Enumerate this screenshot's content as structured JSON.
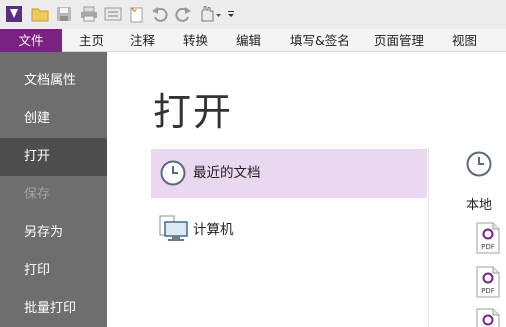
{
  "ribbon": {
    "tabs": [
      "文件",
      "主页",
      "注释",
      "转换",
      "编辑",
      "填写&签名",
      "页面管理",
      "视图"
    ]
  },
  "nav": {
    "items": [
      "文档属性",
      "创建",
      "打开",
      "保存",
      "另存为",
      "打印",
      "批量打印"
    ]
  },
  "open": {
    "title": "打开",
    "locations": [
      "最近的文档",
      "计算机"
    ]
  },
  "recent": {
    "group_label": "本地",
    "file_type": "PDF"
  },
  "colors": {
    "accent": "#7b2383",
    "nav_bg": "#6e6e6e",
    "nav_active": "#4e4e4e",
    "selection": "#ead8f0"
  }
}
